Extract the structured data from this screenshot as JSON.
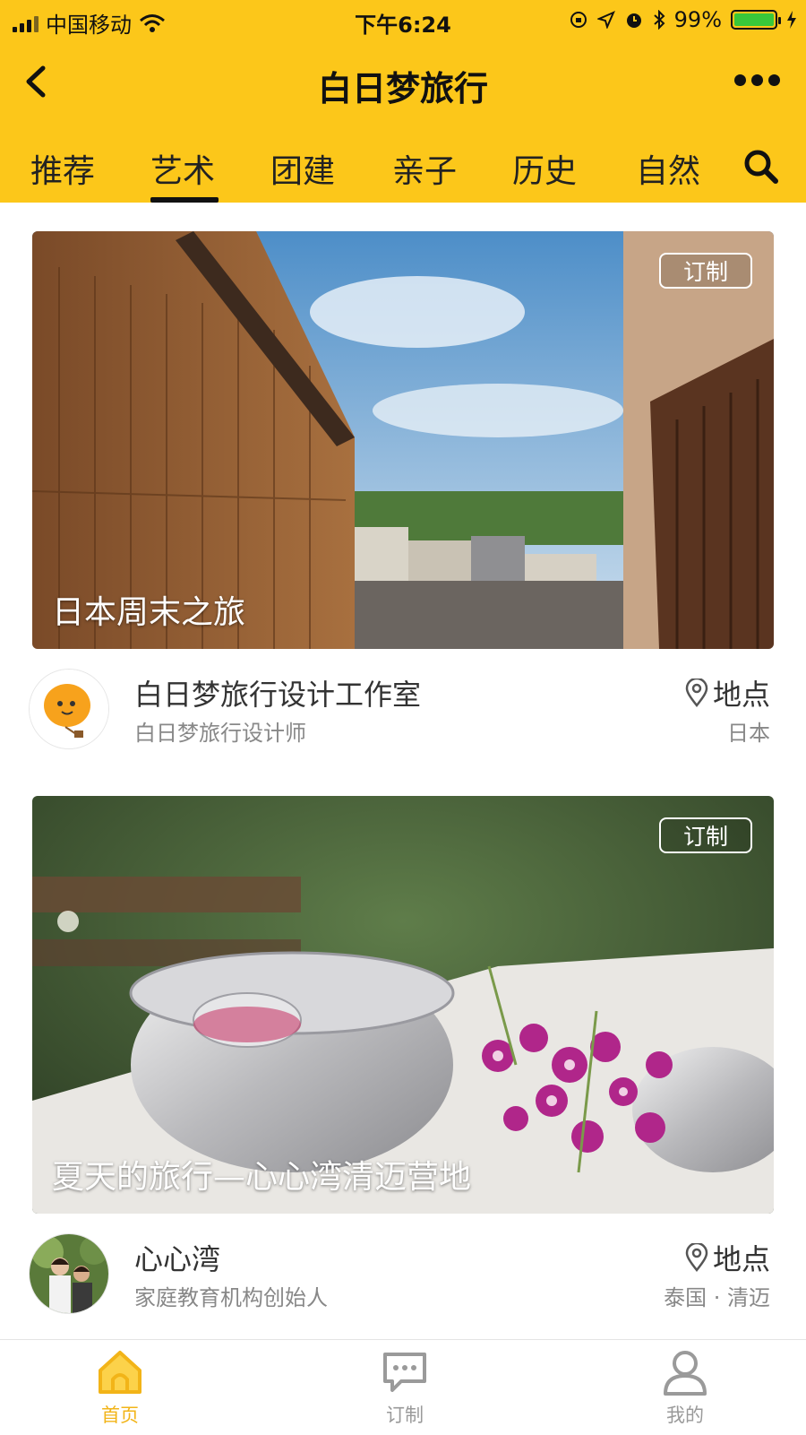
{
  "status_bar": {
    "carrier": "中国移动",
    "time": "下午6:24",
    "battery": "99%",
    "battery_level": 0.99
  },
  "navbar": {
    "title": "白日梦旅行"
  },
  "tabs": [
    {
      "label": "推荐",
      "active": false
    },
    {
      "label": "艺术",
      "active": true
    },
    {
      "label": "团建",
      "active": false
    },
    {
      "label": "亲子",
      "active": false
    },
    {
      "label": "历史",
      "active": false
    },
    {
      "label": "自然",
      "active": false
    }
  ],
  "cards": [
    {
      "badge": "订制",
      "title": "日本周末之旅",
      "author_name": "白日梦旅行设计工作室",
      "author_role": "白日梦旅行设计师",
      "location_label": "地点",
      "location": "日本"
    },
    {
      "badge": "订制",
      "title": "夏天的旅行—心心湾清迈营地",
      "author_name": "心心湾",
      "author_role": "家庭教育机构创始人",
      "location_label": "地点",
      "location": "泰国 · 清迈"
    }
  ],
  "bottom_nav": [
    {
      "label": "首页",
      "icon": "home-icon",
      "active": true
    },
    {
      "label": "订制",
      "icon": "chat-icon",
      "active": false
    },
    {
      "label": "我的",
      "icon": "user-icon",
      "active": false
    }
  ],
  "colors": {
    "brand_yellow": "#fcc71a",
    "active_tab_text": "#f2b418"
  }
}
